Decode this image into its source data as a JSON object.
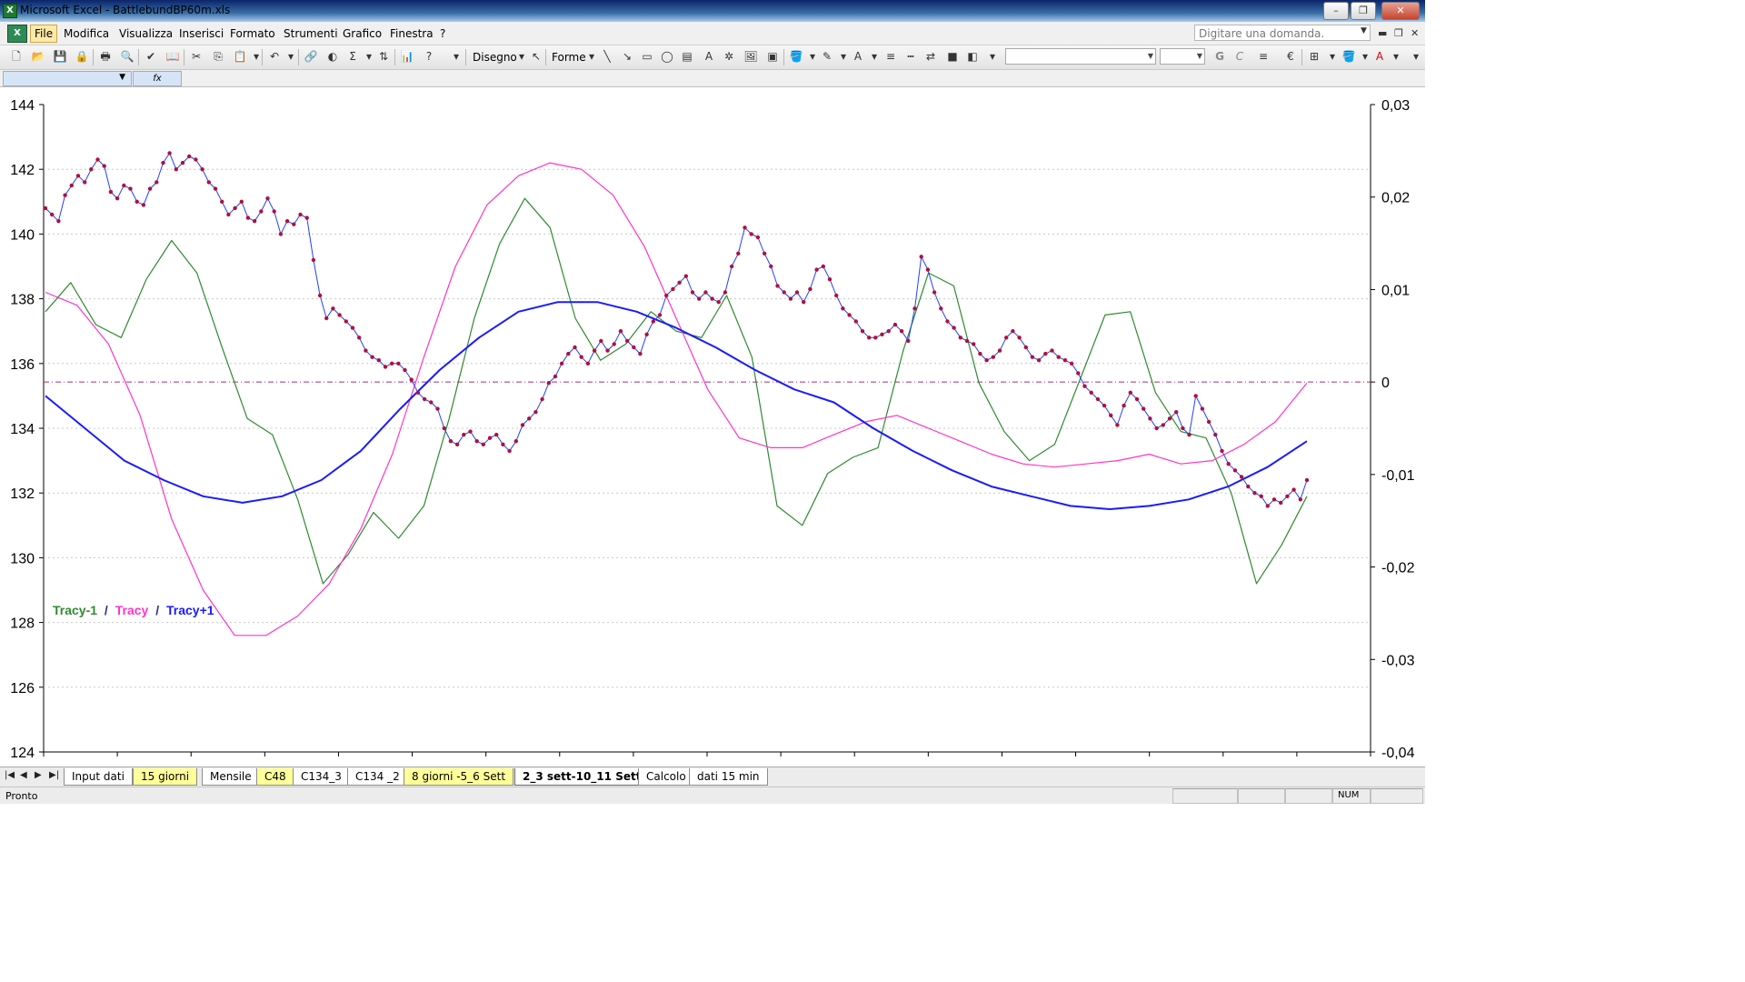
{
  "window": {
    "title": "Microsoft Excel - BattlebundBP60m.xls",
    "minimize": "–",
    "restore": "❐",
    "close": "✕"
  },
  "menu": {
    "items": [
      "File",
      "Modifica",
      "Visualizza",
      "Inserisci",
      "Formato",
      "Strumenti",
      "Grafico",
      "Finestra",
      "?"
    ],
    "active": "File",
    "ask_placeholder": "Digitare una domanda."
  },
  "toolbar": {
    "disegno_label": "Disegno",
    "forme_label": "Forme",
    "bold_g": "G",
    "italic_c": "C",
    "euro": "€"
  },
  "formula_bar": {
    "fx_label": "fx"
  },
  "chart_data": {
    "type": "line",
    "ylim_left": [
      124,
      144
    ],
    "ylim_right": [
      -0.04,
      0.03
    ],
    "y_ticks_left": [
      "144",
      "142",
      "140",
      "138",
      "136",
      "134",
      "132",
      "130",
      "128",
      "126",
      "124"
    ],
    "y_ticks_right": [
      "0,03",
      "0,02",
      "0,01",
      "0",
      "-0,01",
      "-0,02",
      "-0,03",
      "-0,04"
    ],
    "grid": "horizontal dotted",
    "zero_reference_line": 0,
    "legend": {
      "position": "bottom-left",
      "entries": [
        {
          "label": "Tracy-1",
          "color": "#2e8b2e"
        },
        {
          "label": " / ",
          "color": "#2e2e8b"
        },
        {
          "label": "Tracy",
          "color": "#ff33cc"
        },
        {
          "label": " / ",
          "color": "#2e2e8b"
        },
        {
          "label": "Tracy+1",
          "color": "#1a1aff"
        }
      ]
    },
    "price_series_color": "#2040ff",
    "price_marker_color": "#b0103c",
    "price_series": [
      140.8,
      140.6,
      140.4,
      141.2,
      141.5,
      141.8,
      141.6,
      142.0,
      142.3,
      142.1,
      141.3,
      141.1,
      141.5,
      141.4,
      141.0,
      140.9,
      141.4,
      141.6,
      142.2,
      142.5,
      142.0,
      142.2,
      142.4,
      142.3,
      142.0,
      141.6,
      141.4,
      141.0,
      140.6,
      140.8,
      141.0,
      140.5,
      140.4,
      140.7,
      141.1,
      140.7,
      140.0,
      140.4,
      140.3,
      140.6,
      140.5,
      139.2,
      138.1,
      137.4,
      137.7,
      137.5,
      137.3,
      137.1,
      136.8,
      136.4,
      136.2,
      136.1,
      135.9,
      136.0,
      136.0,
      135.8,
      135.5,
      135.1,
      134.9,
      134.8,
      134.6,
      134.0,
      133.6,
      133.5,
      133.8,
      133.9,
      133.6,
      133.5,
      133.7,
      133.8,
      133.5,
      133.3,
      133.6,
      134.1,
      134.3,
      134.5,
      134.9,
      135.4,
      135.6,
      136.0,
      136.3,
      136.5,
      136.2,
      136.0,
      136.4,
      136.7,
      136.4,
      136.6,
      137.0,
      136.7,
      136.5,
      136.3,
      136.9,
      137.3,
      137.5,
      138.1,
      138.3,
      138.5,
      138.7,
      138.2,
      138.0,
      138.2,
      138.0,
      137.9,
      138.2,
      139.0,
      139.4,
      140.2,
      140.0,
      139.9,
      139.4,
      139.0,
      138.4,
      138.2,
      138.0,
      138.2,
      137.9,
      138.3,
      138.9,
      139.0,
      138.6,
      138.1,
      137.7,
      137.5,
      137.3,
      137.0,
      136.8,
      136.8,
      136.9,
      137.0,
      137.2,
      137.0,
      136.7,
      137.7,
      139.3,
      138.9,
      138.2,
      137.7,
      137.3,
      137.1,
      136.8,
      136.7,
      136.6,
      136.3,
      136.1,
      136.2,
      136.4,
      136.8,
      137.0,
      136.8,
      136.5,
      136.2,
      136.1,
      136.3,
      136.4,
      136.2,
      136.1,
      136.0,
      135.7,
      135.3,
      135.1,
      134.9,
      134.7,
      134.4,
      134.1,
      134.7,
      135.1,
      134.9,
      134.6,
      134.3,
      134.0,
      134.1,
      134.3,
      134.5,
      134.0,
      133.8,
      135.0,
      134.6,
      134.2,
      133.8,
      133.3,
      132.9,
      132.7,
      132.5,
      132.2,
      132.0,
      131.9,
      131.6,
      131.8,
      131.7,
      131.9,
      132.1,
      131.8,
      132.4
    ],
    "tracy_minus_1": [
      137.6,
      138.5,
      137.2,
      136.8,
      138.6,
      139.8,
      138.8,
      136.5,
      134.3,
      133.8,
      131.8,
      129.2,
      130.1,
      131.4,
      130.6,
      131.6,
      134.3,
      137.4,
      139.7,
      141.1,
      140.2,
      137.4,
      136.1,
      136.6,
      137.6,
      137.0,
      136.8,
      138.1,
      136.2,
      131.6,
      131.0,
      132.6,
      133.1,
      133.4,
      136.4,
      138.8,
      138.4,
      135.4,
      133.9,
      133.0,
      133.5,
      135.5,
      137.5,
      137.6,
      135.1,
      133.9,
      133.7,
      132.0,
      129.2,
      130.4,
      131.9
    ],
    "tracy": [
      138.2,
      137.8,
      136.6,
      134.4,
      131.2,
      129.0,
      127.6,
      127.6,
      128.2,
      129.2,
      130.9,
      133.2,
      136.2,
      139.0,
      140.9,
      141.8,
      142.2,
      142.0,
      141.2,
      139.6,
      137.4,
      135.2,
      133.7,
      133.4,
      133.4,
      133.8,
      134.2,
      134.4,
      134.0,
      133.6,
      133.2,
      132.9,
      132.8,
      132.9,
      133.0,
      133.2,
      132.9,
      133.0,
      133.5,
      134.2,
      135.4
    ],
    "tracy_plus_1": [
      135.0,
      134.0,
      133.0,
      132.4,
      131.9,
      131.7,
      131.9,
      132.4,
      133.3,
      134.6,
      135.8,
      136.8,
      137.6,
      137.9,
      137.9,
      137.6,
      137.1,
      136.5,
      135.8,
      135.2,
      134.8,
      134.0,
      133.3,
      132.7,
      132.2,
      131.9,
      131.6,
      131.5,
      131.6,
      131.8,
      132.2,
      132.8,
      133.6
    ]
  },
  "sheet_tabs": [
    {
      "label": "Input dati",
      "style": "normal"
    },
    {
      "label": "15 giorni",
      "style": "yellow"
    },
    {
      "label": "Mensile",
      "style": "normal"
    },
    {
      "label": "C48",
      "style": "yellow"
    },
    {
      "label": "C134_3",
      "style": "normal"
    },
    {
      "label": "C134 _2",
      "style": "normal"
    },
    {
      "label": "8 giorni -5_6 Sett",
      "style": "yellow"
    },
    {
      "label": "2_3 sett-10_11 Sett",
      "style": "active"
    },
    {
      "label": "Calcolo",
      "style": "normal"
    },
    {
      "label": "dati 15 min",
      "style": "normal"
    }
  ],
  "status": {
    "text": "Pronto",
    "num": "NUM"
  }
}
